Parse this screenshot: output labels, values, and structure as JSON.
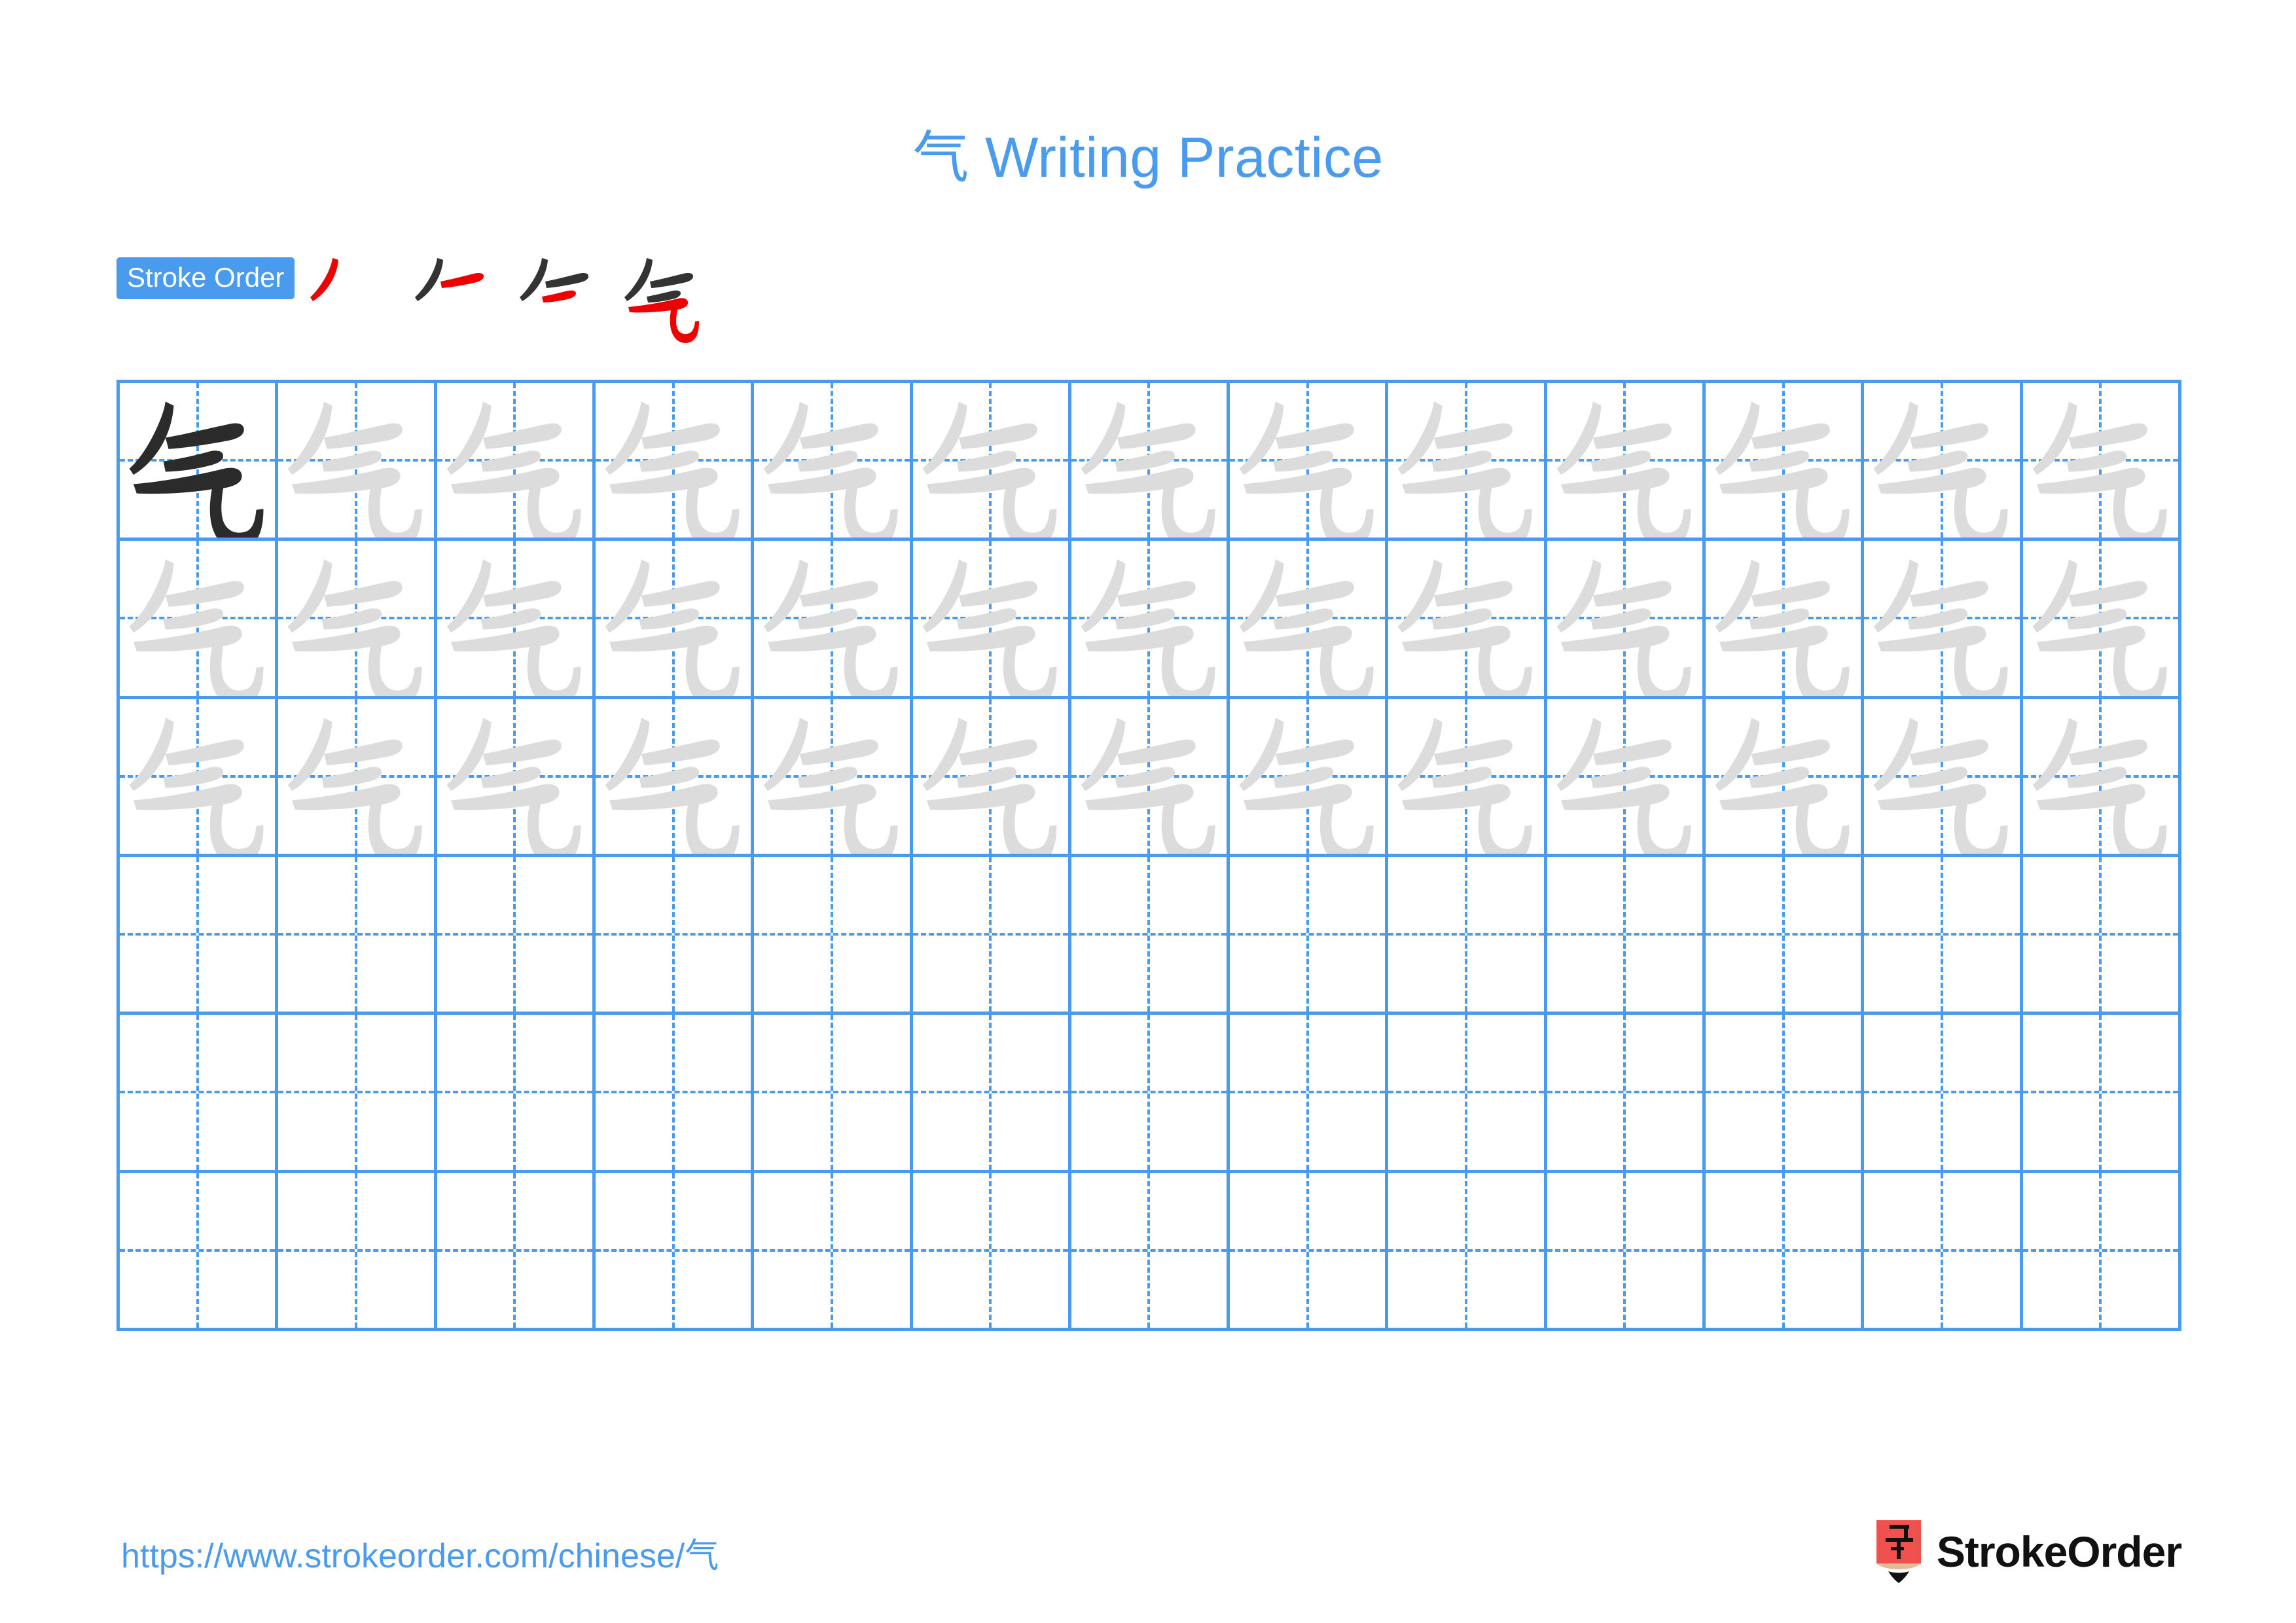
{
  "page": {
    "character": "气",
    "title_suffix": " Writing Practice",
    "title_full": "气 Writing Practice",
    "background_color": "#ffffff",
    "accent_color": "#4a9aee",
    "new_stroke_color": "#ef0000",
    "previous_stroke_color": "#333333",
    "trace_color": "#dcdcdc",
    "model_char_color": "#2b2b2b"
  },
  "stroke_order": {
    "label": "Stroke Order",
    "stroke_count": 4,
    "steps": [
      {
        "index": 1,
        "name": "stroke-step-1",
        "new_stroke": "pie",
        "strokes_shown": 1
      },
      {
        "index": 2,
        "name": "stroke-step-2",
        "new_stroke": "heng",
        "strokes_shown": 2
      },
      {
        "index": 3,
        "name": "stroke-step-3",
        "new_stroke": "heng",
        "strokes_shown": 3
      },
      {
        "index": 4,
        "name": "stroke-step-4",
        "new_stroke": "heng-xie-gou",
        "strokes_shown": 4
      }
    ]
  },
  "grid": {
    "columns": 13,
    "rows": 6,
    "cells": [
      [
        "model",
        "trace",
        "trace",
        "trace",
        "trace",
        "trace",
        "trace",
        "trace",
        "trace",
        "trace",
        "trace",
        "trace",
        "trace"
      ],
      [
        "trace",
        "trace",
        "trace",
        "trace",
        "trace",
        "trace",
        "trace",
        "trace",
        "trace",
        "trace",
        "trace",
        "trace",
        "trace"
      ],
      [
        "trace",
        "trace",
        "trace",
        "trace",
        "trace",
        "trace",
        "trace",
        "trace",
        "trace",
        "trace",
        "trace",
        "trace",
        "trace"
      ],
      [
        "empty",
        "empty",
        "empty",
        "empty",
        "empty",
        "empty",
        "empty",
        "empty",
        "empty",
        "empty",
        "empty",
        "empty",
        "empty"
      ],
      [
        "empty",
        "empty",
        "empty",
        "empty",
        "empty",
        "empty",
        "empty",
        "empty",
        "empty",
        "empty",
        "empty",
        "empty",
        "empty"
      ],
      [
        "empty",
        "empty",
        "empty",
        "empty",
        "empty",
        "empty",
        "empty",
        "empty",
        "empty",
        "empty",
        "empty",
        "empty",
        "empty"
      ]
    ]
  },
  "footer": {
    "url": "https://www.strokeorder.com/chinese/气",
    "brand_name": "StrokeOrder",
    "logo_char": "字",
    "logo_body_color": "#f0514f",
    "logo_wood_color": "#e3bc96",
    "logo_tip_color": "#111111"
  }
}
